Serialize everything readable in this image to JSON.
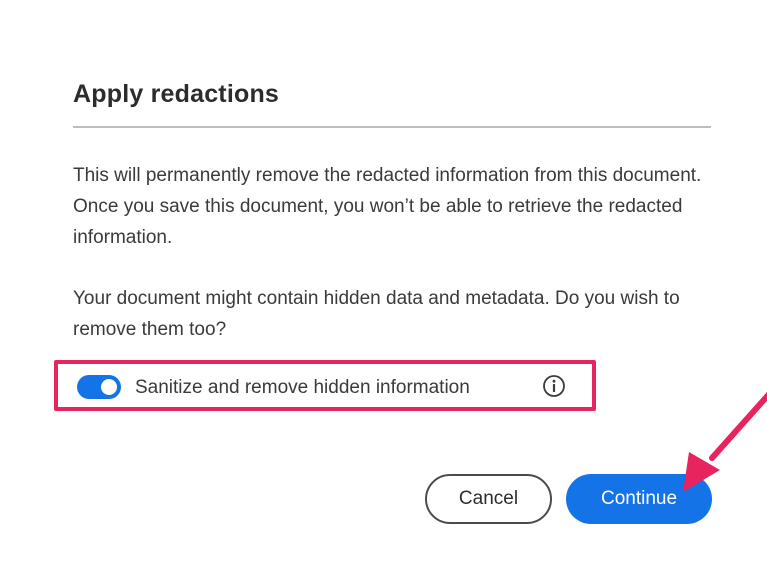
{
  "dialog": {
    "title": "Apply redactions",
    "paragraph1": "This will permanently remove the redacted information from this document. Once you save this document, you won’t be able to retrieve the redacted information.",
    "paragraph2": "Your document might contain hidden data and metadata. Do you wish to remove them too?",
    "toggle": {
      "label": "Sanitize and remove hidden information",
      "state": "on"
    },
    "buttons": {
      "cancel": "Cancel",
      "continue": "Continue"
    }
  },
  "colors": {
    "accent": "#1473e6",
    "highlight": "#e8245e"
  },
  "icons": {
    "info": "info-circle-icon",
    "annotation": "arrow-pointer-icon"
  }
}
